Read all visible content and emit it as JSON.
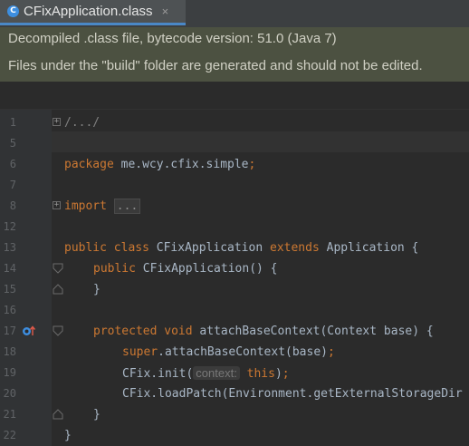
{
  "tab": {
    "title": "CFixApplication.class",
    "icon": "C",
    "close": "×"
  },
  "banner": {
    "line1": "Decompiled .class file, bytecode version: 51.0 (Java 7)",
    "line2": "Files under the \"build\" folder are generated and should not be edited."
  },
  "editor": {
    "line_numbers": [
      "1",
      "5",
      "6",
      "7",
      "8",
      "12",
      "13",
      "14",
      "15",
      "16",
      "17",
      "18",
      "19",
      "20",
      "21",
      "22"
    ],
    "line1": {
      "text": "/.../"
    },
    "line6": {
      "kw": "package",
      "rest": " me.wcy.cfix.simple",
      "semi": ";"
    },
    "line8": {
      "kw": "import",
      "fold": "..."
    },
    "line13": {
      "kw1": "public",
      "kw2": "class",
      "name": " CFixApplication ",
      "kw3": "extends",
      "rest": " Application {"
    },
    "line14": {
      "kw": "public",
      "rest": " CFixApplication() {"
    },
    "line15": {
      "text": "}"
    },
    "line17": {
      "kw1": "protected",
      "kw2": "void",
      "rest": " attachBaseContext(Context base) {"
    },
    "line18": {
      "kw": "super",
      "rest": ".attachBaseContext(base)",
      "semi": ";"
    },
    "line19": {
      "pre": "CFix.init(",
      "hint": "context:",
      "kw": "this",
      "post": ")",
      "semi": ";"
    },
    "line20": {
      "text": "CFix.loadPatch(Environment.getExternalStorageDir"
    },
    "line21": {
      "text": "}"
    },
    "line22": {
      "text": "}"
    }
  },
  "icons": {
    "override": "override-up-icon",
    "fold": "fold-icon"
  },
  "colors": {
    "background": "#2b2b2b",
    "keyword": "#cc7832",
    "text": "#a9b7c6",
    "banner": "#4c5141",
    "tab_accent": "#4a88c7"
  }
}
